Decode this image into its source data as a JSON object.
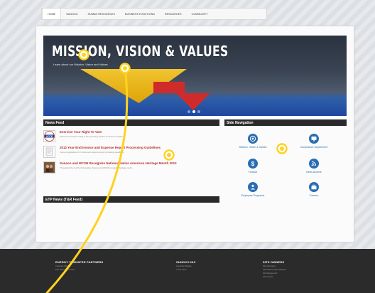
{
  "nav": {
    "items": [
      "HOME",
      "SUNOCO",
      "HUMAN RESOURCES",
      "BUSINESS FUNCTIONS",
      "RESOURCES",
      "COMMUNITY"
    ],
    "active_index": 0
  },
  "hero": {
    "title": "MISSION, VISION & VALUES",
    "subtitle": "Learn about our Mission, Vision and Values",
    "slide_count": 3,
    "active_slide": 1
  },
  "news_feed": {
    "heading": "News Feed",
    "items": [
      {
        "title": "Exercise Your Right To Vote",
        "desc": "Find out more about voting in the upcoming election and how to register.",
        "thumb_icon": "vote-badge-icon"
      },
      {
        "title": "2012 Year-End Invoice and Expense Report Processing Guidelines",
        "desc": "Year-end guidelines for invoice and expense report processing deadlines.",
        "thumb_icon": "document-icon"
      },
      {
        "title": "Sunoco and MCSN Recognize National Native American Heritage Month 2012",
        "desc": "Throughout the month of November, Sunoco and MCSN recognize heritage month.",
        "thumb_icon": "people-icon"
      }
    ]
  },
  "etp_news": {
    "heading": "ETP News (T&R Feed)"
  },
  "side_nav": {
    "heading": "Side Navigation",
    "items": [
      {
        "label": "Mission, Vision & Values",
        "icon": "target-icon"
      },
      {
        "label": "Compliance Department",
        "icon": "monitor-icon"
      },
      {
        "label": "Finance",
        "icon": "dollar-icon"
      },
      {
        "label": "News Archive",
        "icon": "rss-icon"
      },
      {
        "label": "Employee Programs",
        "icon": "person-icon"
      },
      {
        "label": "Careers",
        "icon": "briefcase-icon"
      }
    ]
  },
  "footer": {
    "col1": {
      "heading": "ENERGY TRANSFER PARTNERS",
      "lines": [
        "Corporate Website",
        "ETP Career Resources"
      ]
    },
    "col2": {
      "heading": "SUNOCO INC",
      "lines": [
        "Corporate Website",
        "In The News"
      ]
    },
    "col3": {
      "heading": "SITE OWNERS",
      "lines": [
        "Site Information",
        "SharePoint Feature Request",
        "Site Management",
        "Site Contact"
      ]
    }
  },
  "colors": {
    "accent": "#2a6db3",
    "news_title": "#b52b2b",
    "annotation": "#ffd21f"
  }
}
